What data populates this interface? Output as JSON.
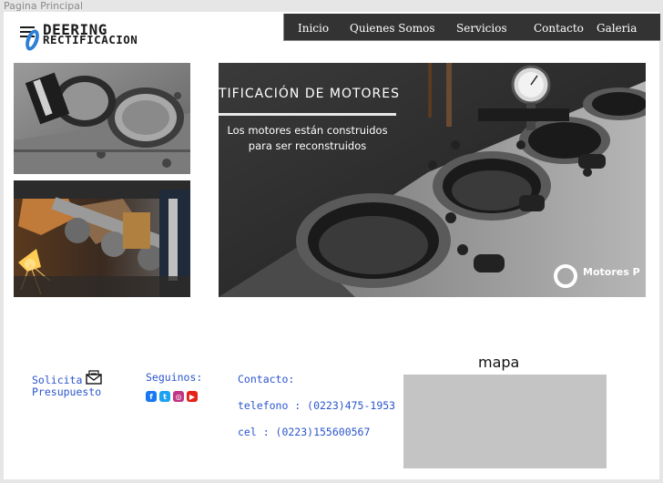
{
  "window": {
    "tab_label": "Pagina Principal"
  },
  "logo": {
    "line1": "DEERING",
    "line2": "RECTIFICACION"
  },
  "nav": {
    "items": [
      "Inicio",
      "Quienes Somos",
      "Servicios",
      "Contacto",
      "Galeria"
    ]
  },
  "hero": {
    "title": "TIFICACIÓN DE MOTORES",
    "subtitle_line1": "Los motores están construidos",
    "subtitle_line2": "para ser reconstruidos",
    "badge": "Motores P"
  },
  "footer": {
    "quote_line1": "Solicita",
    "quote_line2": "Presupuesto",
    "social_label": "Seguinos:",
    "social_icons": [
      "facebook-icon",
      "twitter-icon",
      "instagram-icon",
      "youtube-icon"
    ],
    "contact_label": "Contacto:",
    "phone": "telefono :  (0223)475-1953",
    "cell": "cel : (0223)155600567",
    "map_title": "mapa"
  },
  "colors": {
    "nav_bg": "#333333",
    "link": "#2b55cc",
    "map_placeholder": "#c4c4c4",
    "logo_accent": "#2e7fd6"
  }
}
